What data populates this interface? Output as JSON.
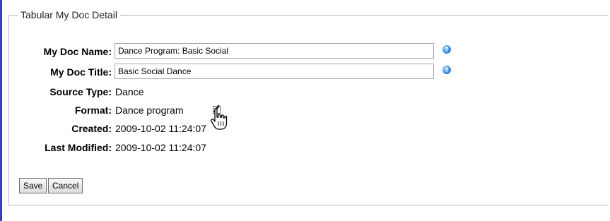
{
  "form": {
    "legend": "Tabular My Doc Detail",
    "fields": {
      "doc_name": {
        "label": "My Doc Name:",
        "value": "Dance Program: Basic Social"
      },
      "doc_title": {
        "label": "My Doc Title:",
        "value": "Basic Social Dance"
      },
      "source_type": {
        "label": "Source Type:",
        "value": "Dance"
      },
      "format": {
        "label": "Format:",
        "value": "Dance program"
      },
      "created": {
        "label": "Created:",
        "value": "2009-10-02 11:24:07"
      },
      "last_modified": {
        "label": "Last Modified:",
        "value": "2009-10-02 11:24:07"
      }
    },
    "buttons": {
      "save": "Save",
      "cancel": "Cancel"
    },
    "icons": {
      "help": "help-icon",
      "edit": "edit-icon",
      "cursor": "hand-pointer-icon"
    }
  }
}
